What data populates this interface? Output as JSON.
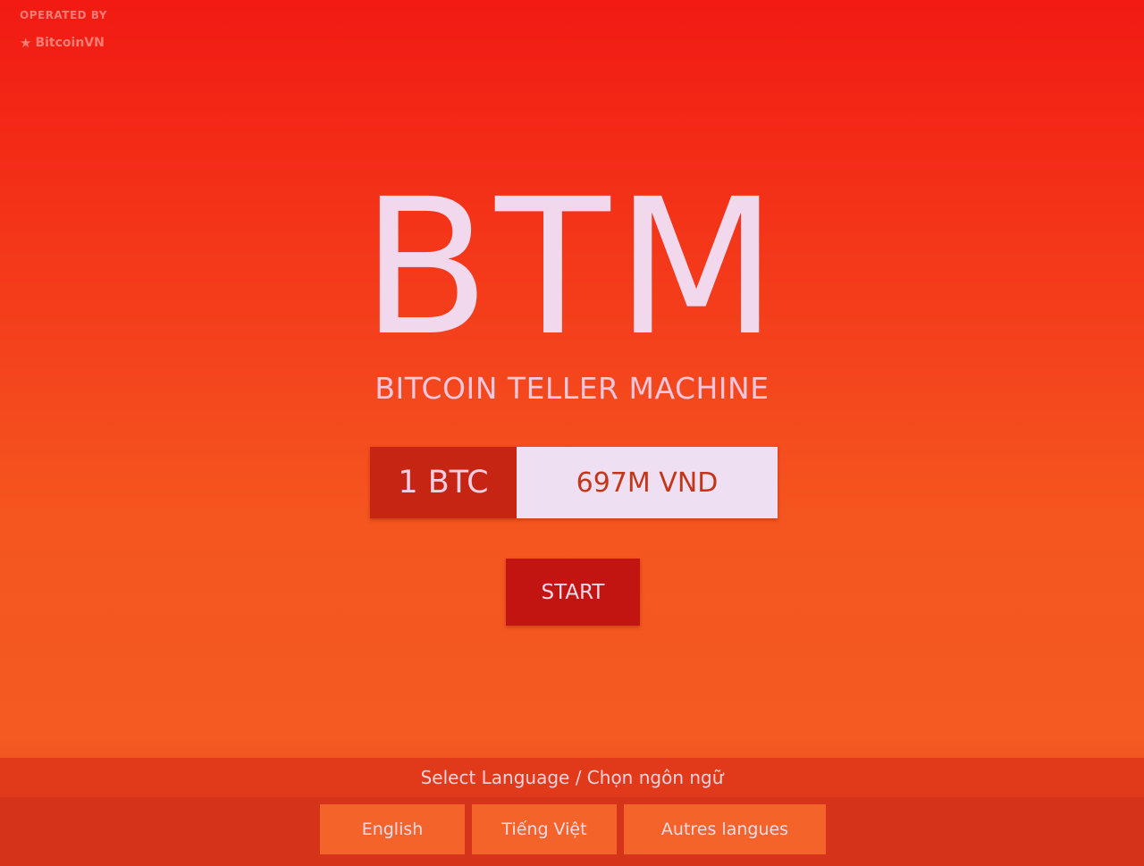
{
  "operator": {
    "caption": "OPERATED BY",
    "brand_name": "BitcoinVN",
    "brand_icon": "bitcoinvn-logo-icon"
  },
  "hero": {
    "title": "BTM",
    "subtitle": "BITCOIN TELLER MACHINE"
  },
  "rate": {
    "unit": "1 BTC",
    "price": "697M VND"
  },
  "actions": {
    "start_label": "START"
  },
  "language": {
    "prompt": "Select Language / Chọn ngôn ngữ",
    "options": [
      "English",
      "Tiếng Việt",
      "Autres langues"
    ]
  },
  "colors": {
    "background": "#f43d1b",
    "start_button": "#c21512",
    "rate_unit_bg": "#c72514",
    "rate_price_bg": "#eee0f2",
    "language_button": "#f4632a"
  }
}
